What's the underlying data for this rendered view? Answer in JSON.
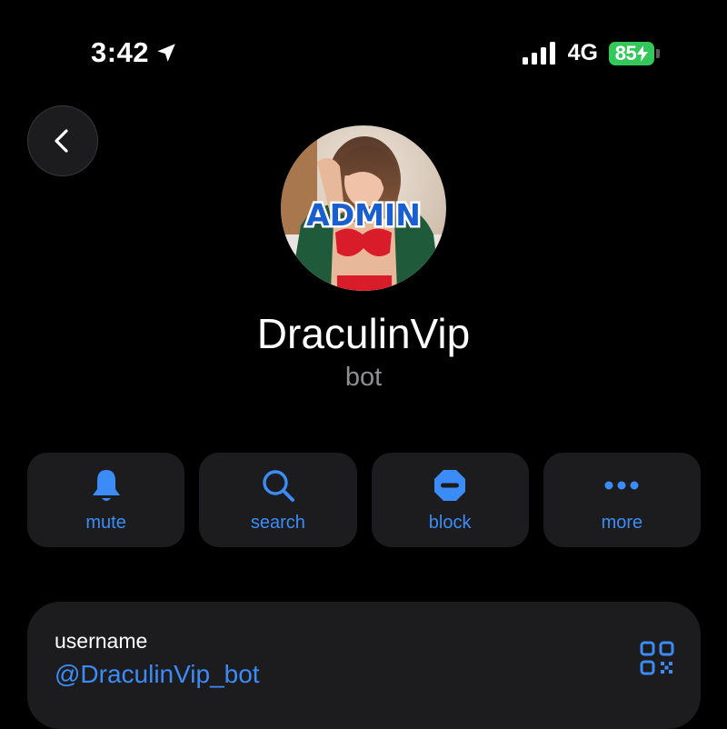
{
  "status_bar": {
    "time": "3:42",
    "location_icon": "location-arrow-icon",
    "signal_icon": "cellular-signal-icon",
    "network": "4G",
    "battery_percent": "85",
    "battery_icon": "battery-charging-icon",
    "battery_color": "#34c759"
  },
  "header": {
    "back_icon": "chevron-left-icon"
  },
  "profile": {
    "avatar_badge": "ADMIN",
    "name": "DraculinVip",
    "subtitle": "bot"
  },
  "actions": [
    {
      "label": "mute",
      "icon": "bell-icon"
    },
    {
      "label": "search",
      "icon": "search-icon"
    },
    {
      "label": "block",
      "icon": "block-icon"
    },
    {
      "label": "more",
      "icon": "more-dots-icon"
    }
  ],
  "info": {
    "label": "username",
    "value": "@DraculinVip_bot",
    "qr_icon": "qr-code-icon"
  },
  "colors": {
    "accent": "#3b8cf7",
    "background": "#000000",
    "card": "#1c1c1e",
    "secondary_text": "#8e8e93"
  }
}
